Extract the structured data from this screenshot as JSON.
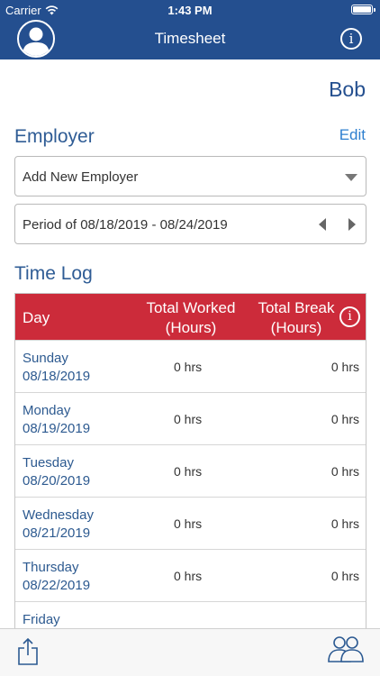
{
  "status": {
    "carrier": "Carrier",
    "time": "1:43 PM"
  },
  "nav": {
    "title": "Timesheet"
  },
  "user": {
    "name": "Bob"
  },
  "employer": {
    "section_title": "Employer",
    "edit_label": "Edit",
    "selected": "Add New Employer",
    "period": "Period of 08/18/2019 - 08/24/2019"
  },
  "timelog": {
    "section_title": "Time Log",
    "headers": {
      "day": "Day",
      "worked_1": "Total Worked",
      "worked_2": "(Hours)",
      "break_1": "Total Break",
      "break_2": "(Hours)"
    },
    "rows": [
      {
        "day": "Sunday",
        "date": "08/18/2019",
        "worked": "0 hrs",
        "break": "0 hrs"
      },
      {
        "day": "Monday",
        "date": "08/19/2019",
        "worked": "0 hrs",
        "break": "0 hrs"
      },
      {
        "day": "Tuesday",
        "date": "08/20/2019",
        "worked": "0 hrs",
        "break": "0 hrs"
      },
      {
        "day": "Wednesday",
        "date": "08/21/2019",
        "worked": "0 hrs",
        "break": "0 hrs"
      },
      {
        "day": "Thursday",
        "date": "08/22/2019",
        "worked": "0 hrs",
        "break": "0 hrs"
      },
      {
        "day": "Friday",
        "date": "",
        "worked": "",
        "break": ""
      }
    ]
  },
  "icons": {
    "avatar": "user-avatar-icon",
    "info": "info-icon",
    "share": "share-icon",
    "contacts": "people-icon"
  },
  "colors": {
    "nav": "#244f8f",
    "header_red": "#cc2b3a",
    "link": "#2e7fcf"
  }
}
